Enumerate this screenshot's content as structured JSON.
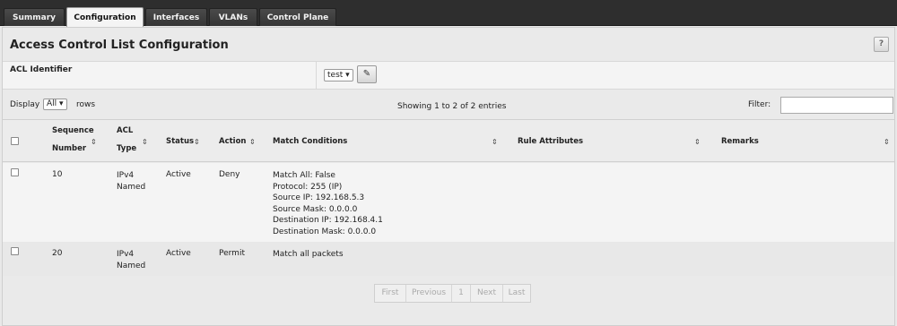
{
  "tabs": [
    {
      "label": "Summary",
      "active": false
    },
    {
      "label": "Configuration",
      "active": true
    },
    {
      "label": "Interfaces",
      "active": false
    },
    {
      "label": "VLANs",
      "active": false
    },
    {
      "label": "Control Plane",
      "active": false
    }
  ],
  "page": {
    "title": "Access Control List Configuration",
    "help_label": "?"
  },
  "acl": {
    "label": "ACL Identifier",
    "selected": "test ▾"
  },
  "controls": {
    "display_label": "Display",
    "rows_selected": "All ▾",
    "rows_label": "rows",
    "showing": "Showing 1 to 2 of 2 entries",
    "filter_label": "Filter:",
    "filter_value": ""
  },
  "columns": {
    "sequence_1": "Sequence",
    "sequence_2": "Number",
    "acl_1": "ACL",
    "acl_2": "Type",
    "status": "Status",
    "action": "Action",
    "match": "Match Conditions",
    "rule": "Rule Attributes",
    "remarks": "Remarks"
  },
  "rows": [
    {
      "sequence": "10",
      "type_1": "IPv4",
      "type_2": "Named",
      "status": "Active",
      "action": "Deny",
      "match": [
        "Match All: False",
        "Protocol: 255 (IP)",
        "Source IP: 192.168.5.3",
        "Source Mask: 0.0.0.0",
        "Destination IP: 192.168.4.1",
        "Destination Mask: 0.0.0.0"
      ],
      "rule": "",
      "remarks": ""
    },
    {
      "sequence": "20",
      "type_1": "IPv4",
      "type_2": "Named",
      "status": "Active",
      "action": "Permit",
      "match": [
        "Match all packets"
      ],
      "rule": "",
      "remarks": ""
    }
  ],
  "pager": {
    "first": "First",
    "previous": "Previous",
    "page": "1",
    "next": "Next",
    "last": "Last"
  },
  "icons": {
    "sort": "sort-arrows-icon",
    "edit": "pencil-icon"
  }
}
